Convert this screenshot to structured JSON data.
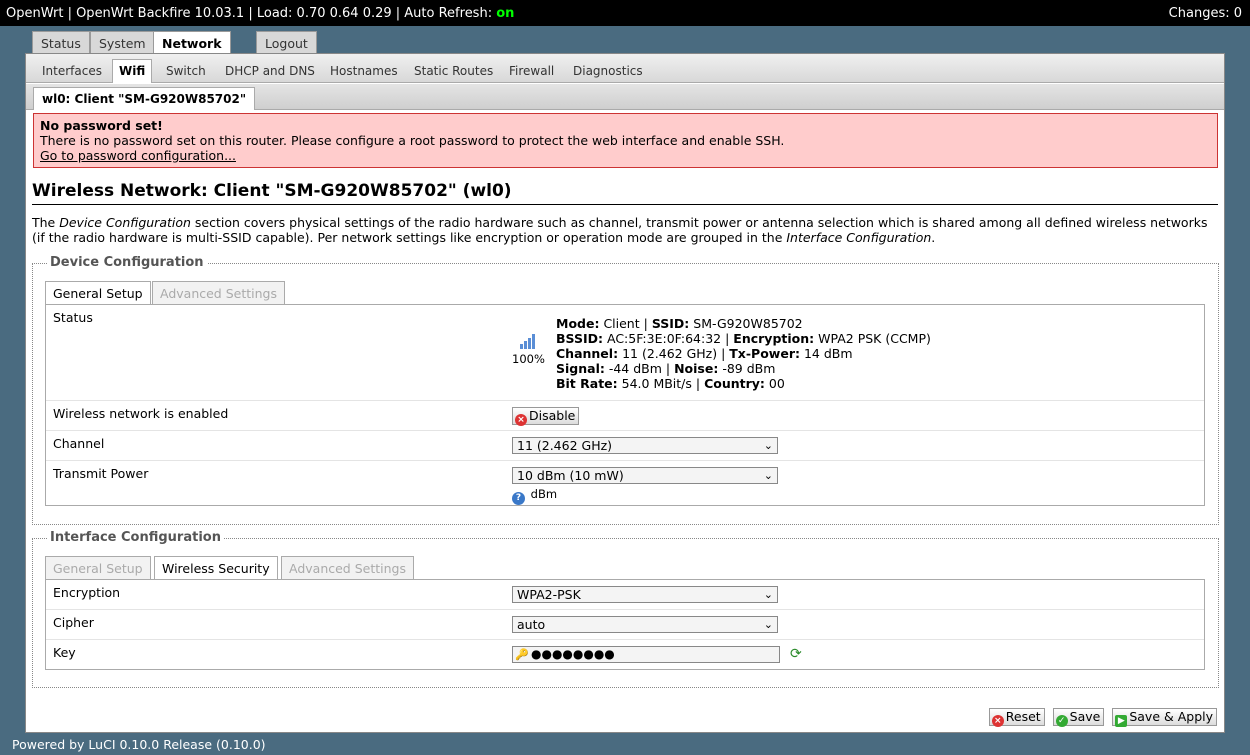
{
  "topbar": {
    "title": "OpenWrt | OpenWrt Backfire 10.03.1 | Load: 0.70 0.64 0.29 | Auto Refresh:",
    "auto_refresh": "on",
    "changes": "Changes: 0"
  },
  "top_tabs": {
    "status": "Status",
    "system": "System",
    "network": "Network",
    "logout": "Logout"
  },
  "sub_tabs": {
    "interfaces": "Interfaces",
    "wifi": "Wifi",
    "switch": "Switch",
    "dhcp": "DHCP and DNS",
    "hostnames": "Hostnames",
    "static_routes": "Static Routes",
    "firewall": "Firewall",
    "diagnostics": "Diagnostics"
  },
  "iface_tab": "wl0: Client \"SM-G920W85702\"",
  "alert": {
    "title": "No password set!",
    "message": "There is no password set on this router. Please configure a root password to protect the web interface and enable SSH.",
    "link": "Go to password configuration..."
  },
  "page_title": "Wireless Network: Client \"SM-G920W85702\" (wl0)",
  "description": {
    "p1": "The ",
    "em1": "Device Configuration",
    "p2": " section covers physical settings of the radio hardware such as channel, transmit power or antenna selection which is shared among all defined wireless networks (if the radio hardware is multi-SSID capable). Per network settings like encryption or operation mode are grouped in the ",
    "em2": "Interface Configuration",
    "p3": "."
  },
  "device_config": {
    "legend": "Device Configuration",
    "tab_general": "General Setup",
    "tab_advanced": "Advanced Settings",
    "status_label": "Status",
    "signal_percent": "100%",
    "status": {
      "mode_label": "Mode:",
      "mode": "Client",
      "ssid_label": "SSID:",
      "ssid": "SM-G920W85702",
      "bssid_label": "BSSID:",
      "bssid": "AC:5F:3E:0F:64:32",
      "enc_label": "Encryption:",
      "enc": "WPA2 PSK (CCMP)",
      "channel_label": "Channel:",
      "channel": "11 (2.462 GHz)",
      "txpower_label": "Tx-Power:",
      "txpower": "14 dBm",
      "signal_label": "Signal:",
      "signal": "-44 dBm",
      "noise_label": "Noise:",
      "noise": "-89 dBm",
      "bitrate_label": "Bit Rate:",
      "bitrate": "54.0 MBit/s",
      "country_label": "Country:",
      "country": "00"
    },
    "enabled_label": "Wireless network is enabled",
    "disable_button": "Disable",
    "channel_label": "Channel",
    "channel_value": "11 (2.462 GHz)",
    "txpower_label": "Transmit Power",
    "txpower_value": "10 dBm (10 mW)",
    "txpower_hint": "dBm"
  },
  "iface_config": {
    "legend": "Interface Configuration",
    "tab_general": "General Setup",
    "tab_security": "Wireless Security",
    "tab_advanced": "Advanced Settings",
    "encryption_label": "Encryption",
    "encryption_value": "WPA2-PSK",
    "cipher_label": "Cipher",
    "cipher_value": "auto",
    "key_label": "Key",
    "key_value": "●●●●●●●●"
  },
  "buttons": {
    "reset": "Reset",
    "save": "Save",
    "save_apply": "Save & Apply"
  },
  "footer": "Powered by LuCI 0.10.0 Release (0.10.0)"
}
